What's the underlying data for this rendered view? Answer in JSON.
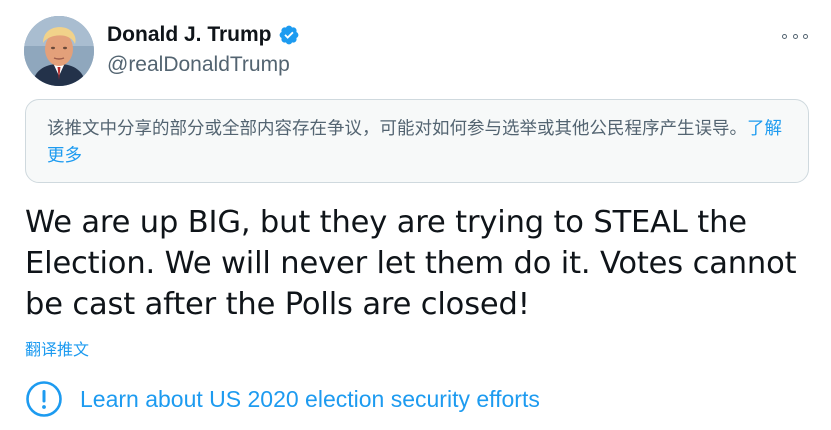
{
  "author": {
    "name": "Donald J. Trump",
    "handle": "@realDonaldTrump",
    "verified_icon": "verified-badge-icon",
    "avatar": "profile-photo"
  },
  "more_menu": {
    "icon": "more-options-icon"
  },
  "notice": {
    "text": "该推文中分享的部分或全部内容存在争议，可能对如何参与选举或其他公民程序产生误导。",
    "link_label": "了解更多"
  },
  "tweet": {
    "text": "We are up BIG, but they are trying to STEAL the Election. We will never let them do it. Votes cannot be cast after the Polls are closed!"
  },
  "translate_label": "翻译推文",
  "election_info": {
    "icon": "info-circle-icon",
    "label": "Learn about US 2020 election security efforts"
  },
  "colors": {
    "link": "#1d9bf0",
    "text": "#0f1419",
    "muted": "#536471",
    "notice_bg": "#f7f9f9",
    "notice_border": "#cfd9de"
  }
}
